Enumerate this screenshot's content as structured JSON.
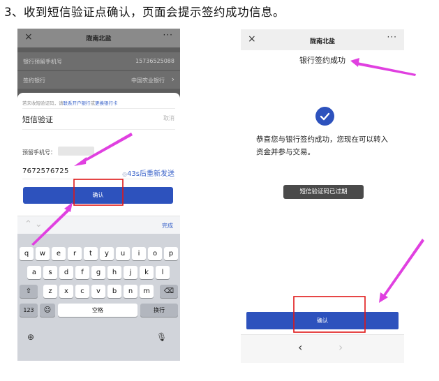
{
  "instruction": "3、收到短信验证点确认，页面会提示签约成功信息。",
  "left": {
    "nav_title": "陇南北盐",
    "close_glyph": "×",
    "more_glyph": "···",
    "rows": [
      {
        "label": "银行预留手机号",
        "value": "15736525088"
      },
      {
        "label": "签约银行",
        "value": "中国农业银行"
      }
    ],
    "row_chevron": "›",
    "hint_prefix": "若未收短验证码，请",
    "hint_link1": "联系开户银行",
    "hint_mid": "或",
    "hint_link2": "更换银行卡",
    "sms_title": "短信验证",
    "cancel_label": "取消",
    "phone_label": "预留手机号：",
    "code_value": "7672576725",
    "timer_text": "43s后重新发送",
    "confirm_label": "确认",
    "done_label": "完成",
    "keyboard": {
      "row1": [
        "q",
        "w",
        "e",
        "r",
        "t",
        "y",
        "u",
        "i",
        "o",
        "p"
      ],
      "row2": [
        "a",
        "s",
        "d",
        "f",
        "g",
        "h",
        "j",
        "k",
        "l"
      ],
      "row3": [
        "z",
        "x",
        "c",
        "v",
        "b",
        "n",
        "m"
      ],
      "num_label": "123",
      "space_label": "空格",
      "return_label": "换行"
    }
  },
  "right": {
    "nav_title": "陇南北盐",
    "close_glyph": "×",
    "more_glyph": "···",
    "heading": "银行签约成功",
    "message": "恭喜您与银行签约成功，您现在可以转入资金并参与交易。",
    "toast": "短信验证码已过期",
    "confirm_label": "确认",
    "back_glyph": "‹",
    "forward_glyph": "›"
  },
  "colors": {
    "accent": "#2d52bd",
    "annotation": "#e040e0",
    "highlight_box": "#e01818"
  }
}
